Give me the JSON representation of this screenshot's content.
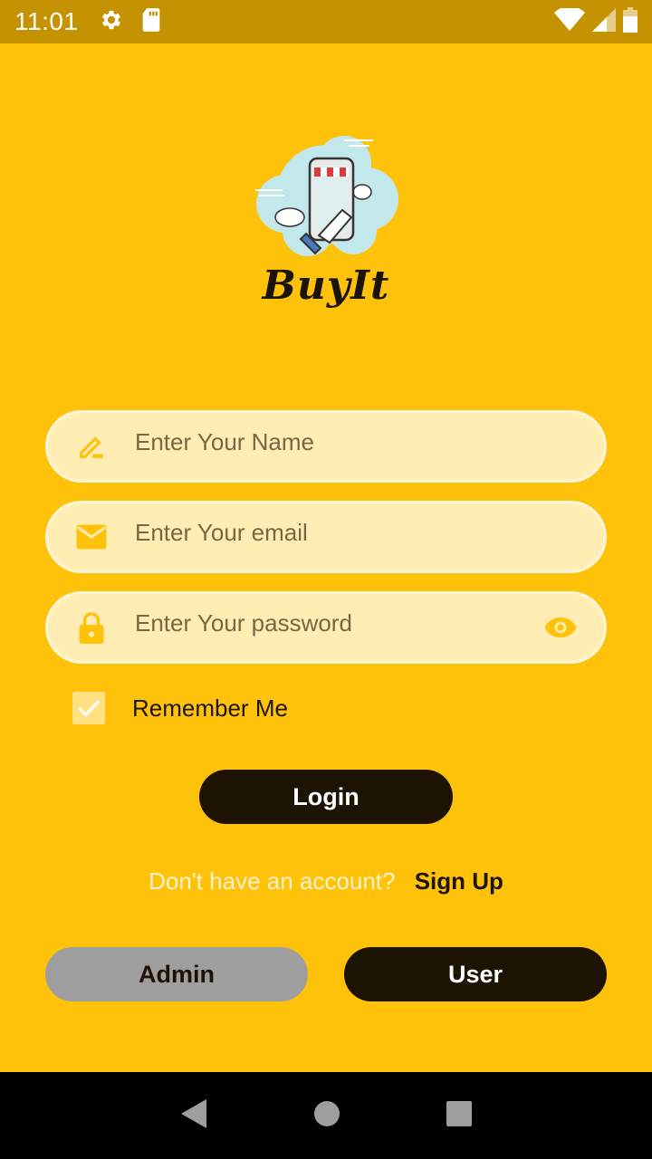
{
  "status_bar": {
    "time": "11:01"
  },
  "app": {
    "logo_text": "BuyIt"
  },
  "form": {
    "name_placeholder": "Enter Your Name",
    "email_placeholder": "Enter Your email",
    "password_placeholder": "Enter Your password",
    "remember_label": "Remember Me",
    "remember_checked": true
  },
  "actions": {
    "login_label": "Login",
    "signup_prompt": "Don't have an account?",
    "signup_link": "Sign Up",
    "admin_label": "Admin",
    "user_label": "User"
  },
  "colors": {
    "background": "#FFC20A",
    "status_bar": "#C59202",
    "field_bg": "#FFEDB3",
    "dark": "#1C1302",
    "icon": "#FFC20A",
    "admin_bg": "#9E9E9E"
  },
  "icons": {
    "status": [
      "settings-icon",
      "sd-card-icon",
      "wifi-icon",
      "signal-icon",
      "battery-icon"
    ],
    "fields": [
      "pencil-icon",
      "mail-icon",
      "lock-icon",
      "eye-icon"
    ],
    "nav": [
      "back-icon",
      "home-icon",
      "recents-icon"
    ]
  }
}
